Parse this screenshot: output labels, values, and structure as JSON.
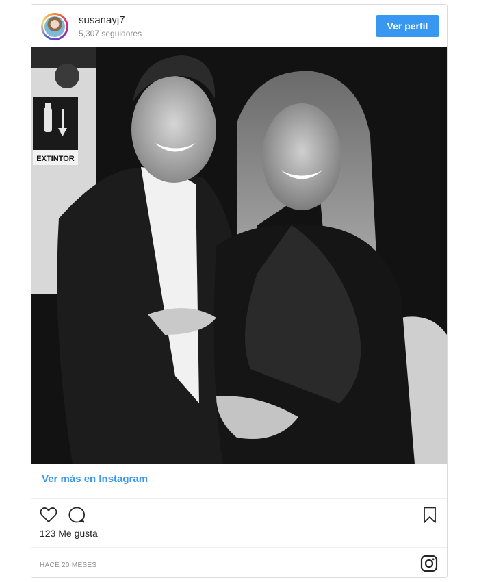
{
  "post": {
    "username": "susanayj7",
    "followers": "5,307 seguidores",
    "profile_button": "Ver perfil",
    "photo_sign_text": "EXTINTOR",
    "ig_link": "Ver más en Instagram",
    "likes": "123 Me gusta",
    "timestamp": "HACE 20 MESES"
  },
  "icons": {
    "like": "heart-icon",
    "comment": "comment-bubble-icon",
    "save": "bookmark-icon",
    "brand": "instagram-icon",
    "photo_sign": "fire-extinguisher-icon"
  },
  "colors": {
    "accent": "#3897f0",
    "text": "#262626",
    "muted": "#8e8e8e",
    "border": "#dbdbdb"
  }
}
